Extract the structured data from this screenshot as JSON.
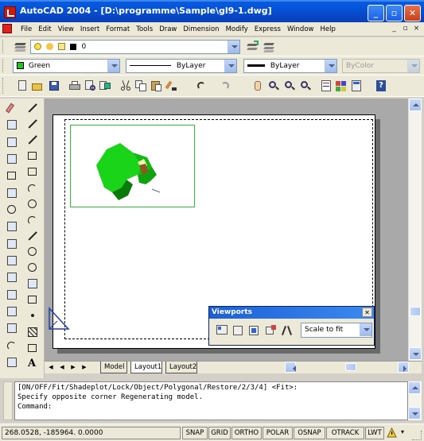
{
  "window": {
    "title": "AutoCAD 2004 - [D:\\programme\\Sample\\gl9-1.dwg]",
    "minimize_glyph": "_",
    "maximize_glyph": "▫",
    "close_glyph": "✕"
  },
  "menu": {
    "items": [
      "File",
      "Edit",
      "View",
      "Insert",
      "Format",
      "Tools",
      "Draw",
      "Dimension",
      "Modify",
      "Express",
      "Window",
      "Help"
    ],
    "mdi_controls": [
      "_",
      "▫",
      "×"
    ]
  },
  "layers": {
    "current_layer": "0"
  },
  "properties": {
    "color": "Green",
    "linetype": "ByLayer",
    "lineweight": "ByLayer",
    "plotstyle": "ByColor",
    "color_swatch": "#22c422"
  },
  "viewports_toolbar": {
    "title": "Viewports",
    "scale_value": "Scale to fit"
  },
  "tabs": {
    "nav": [
      "◀",
      "◀",
      "▶",
      "▶"
    ],
    "items": [
      "Model",
      "Layout1",
      "Layout2"
    ],
    "active_index": 1
  },
  "command": {
    "lines": [
      "[ON/OFF/Fit/Shadeplot/Lock/Object/Polygonal/Restore/2/3/4] <Fit>:",
      "Specify opposite corner  Regenerating model.",
      "Command:"
    ]
  },
  "status": {
    "coordinates": "268.0528, -185964. 0.0000",
    "buttons": [
      "SNAP",
      "GRID",
      "ORTHO",
      "POLAR",
      "OSNAP",
      "OTRACK",
      "LWT"
    ]
  },
  "colors": {
    "model_green": "#19d419",
    "model_dark": "#0a6a0a",
    "accent_blue": "#0a5ae0"
  }
}
